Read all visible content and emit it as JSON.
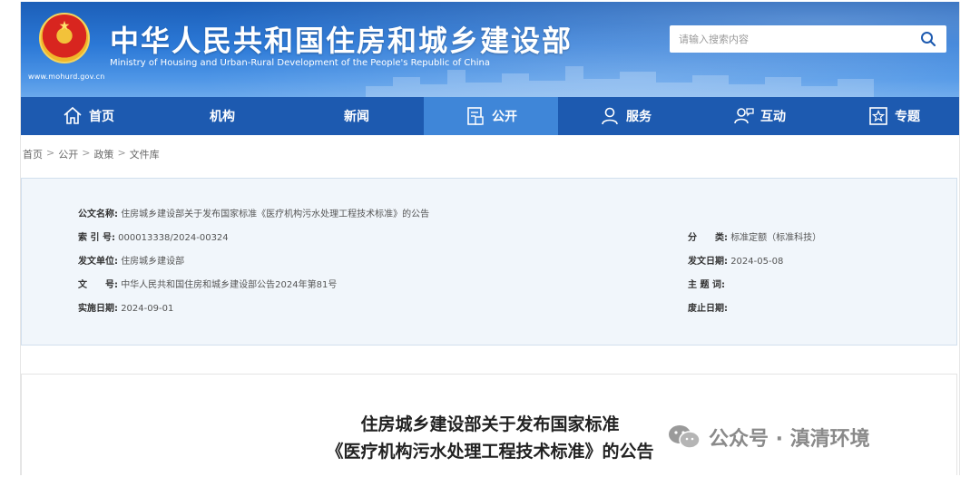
{
  "header": {
    "site_url": "www.mohurd.gov.cn",
    "title": "中华人民共和国住房和城乡建设部",
    "subtitle": "Ministry of Housing and Urban-Rural Development of the People's Republic of China",
    "emblem_icon": "national-emblem-icon"
  },
  "search": {
    "placeholder": "请输入搜索内容",
    "icon": "search-icon"
  },
  "nav": {
    "items": [
      {
        "label": "首页",
        "icon": "home-icon"
      },
      {
        "label": "机构",
        "icon": ""
      },
      {
        "label": "新闻",
        "icon": ""
      },
      {
        "label": "公开",
        "icon": "document-icon",
        "active": true
      },
      {
        "label": "服务",
        "icon": "user-service-icon"
      },
      {
        "label": "互动",
        "icon": "interaction-icon"
      },
      {
        "label": "专题",
        "icon": "star-icon"
      }
    ]
  },
  "breadcrumb": [
    "首页",
    "公开",
    "政策",
    "文件库"
  ],
  "breadcrumb_separator": ">",
  "document_info": {
    "name_label": "公文名称:",
    "name_value": "住房城乡建设部关于发布国家标准《医疗机构污水处理工程技术标准》的公告",
    "index_label": "索 引 号:",
    "index_value": "000013338/2024-00324",
    "category_label": "分　　类:",
    "category_value": "标准定额（标准科技）",
    "issuer_label": "发文单位:",
    "issuer_value": "住房城乡建设部",
    "date_label": "发文日期:",
    "date_value": "2024-05-08",
    "number_label": "文　　号:",
    "number_value": "中华人民共和国住房和城乡建设部公告2024年第81号",
    "keywords_label": "主 题 词:",
    "keywords_value": "",
    "effective_label": "实施日期:",
    "effective_value": "2024-09-01",
    "expiry_label": "废止日期:",
    "expiry_value": ""
  },
  "document": {
    "title_line1": "住房城乡建设部关于发布国家标准",
    "title_line2": "《医疗机构污水处理工程技术标准》的公告"
  },
  "watermark": {
    "text": "公众号 · 滇清环境",
    "icon": "wechat-icon"
  },
  "colors": {
    "header_blue": "#2b78d6",
    "nav_blue": "#1d5ab0",
    "nav_active": "#3f86d8",
    "panel_bg": "#f1f6fb"
  }
}
